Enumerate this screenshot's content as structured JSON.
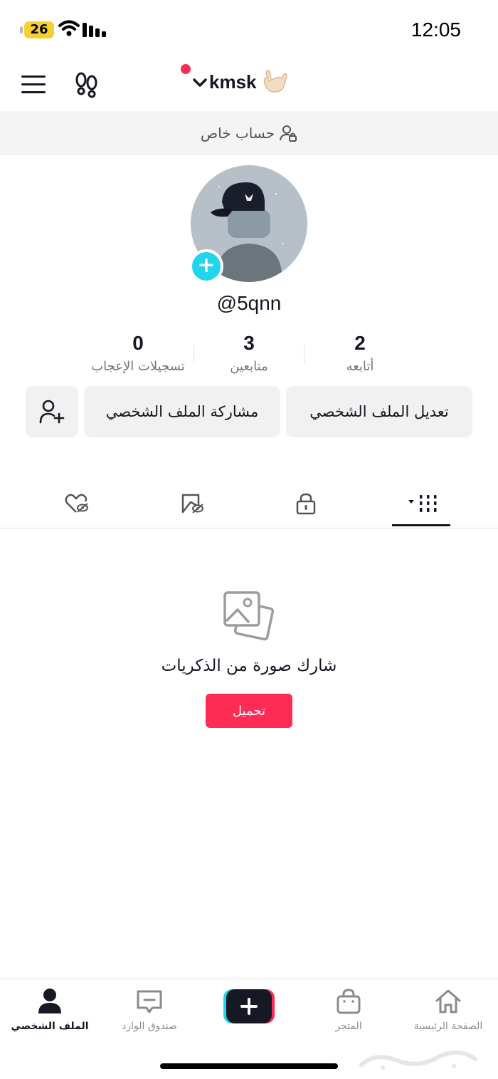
{
  "status_bar": {
    "battery": "26",
    "time": "12:05"
  },
  "header": {
    "username": "kmsk"
  },
  "private_banner": {
    "label": "حساب خاص"
  },
  "profile": {
    "handle": "@5qnn"
  },
  "stats": {
    "following": {
      "value": "2",
      "label": "أتابعه"
    },
    "followers": {
      "value": "3",
      "label": "متابعين"
    },
    "likes": {
      "value": "0",
      "label": "تسجيلات الإعجاب"
    }
  },
  "actions": {
    "edit_profile": "تعديل الملف الشخصي",
    "share_profile": "مشاركة الملف الشخصي"
  },
  "empty_state": {
    "title": "شارك صورة من الذكريات",
    "upload": "تحميل"
  },
  "bottom_nav": {
    "home": "الصفحة الرئيسية",
    "shop": "المتجر",
    "inbox": "صندوق الوارد",
    "profile": "الملف الشخصي"
  },
  "colors": {
    "accent": "#fe2c55",
    "cyan": "#20d5ec",
    "text": "#161823"
  }
}
